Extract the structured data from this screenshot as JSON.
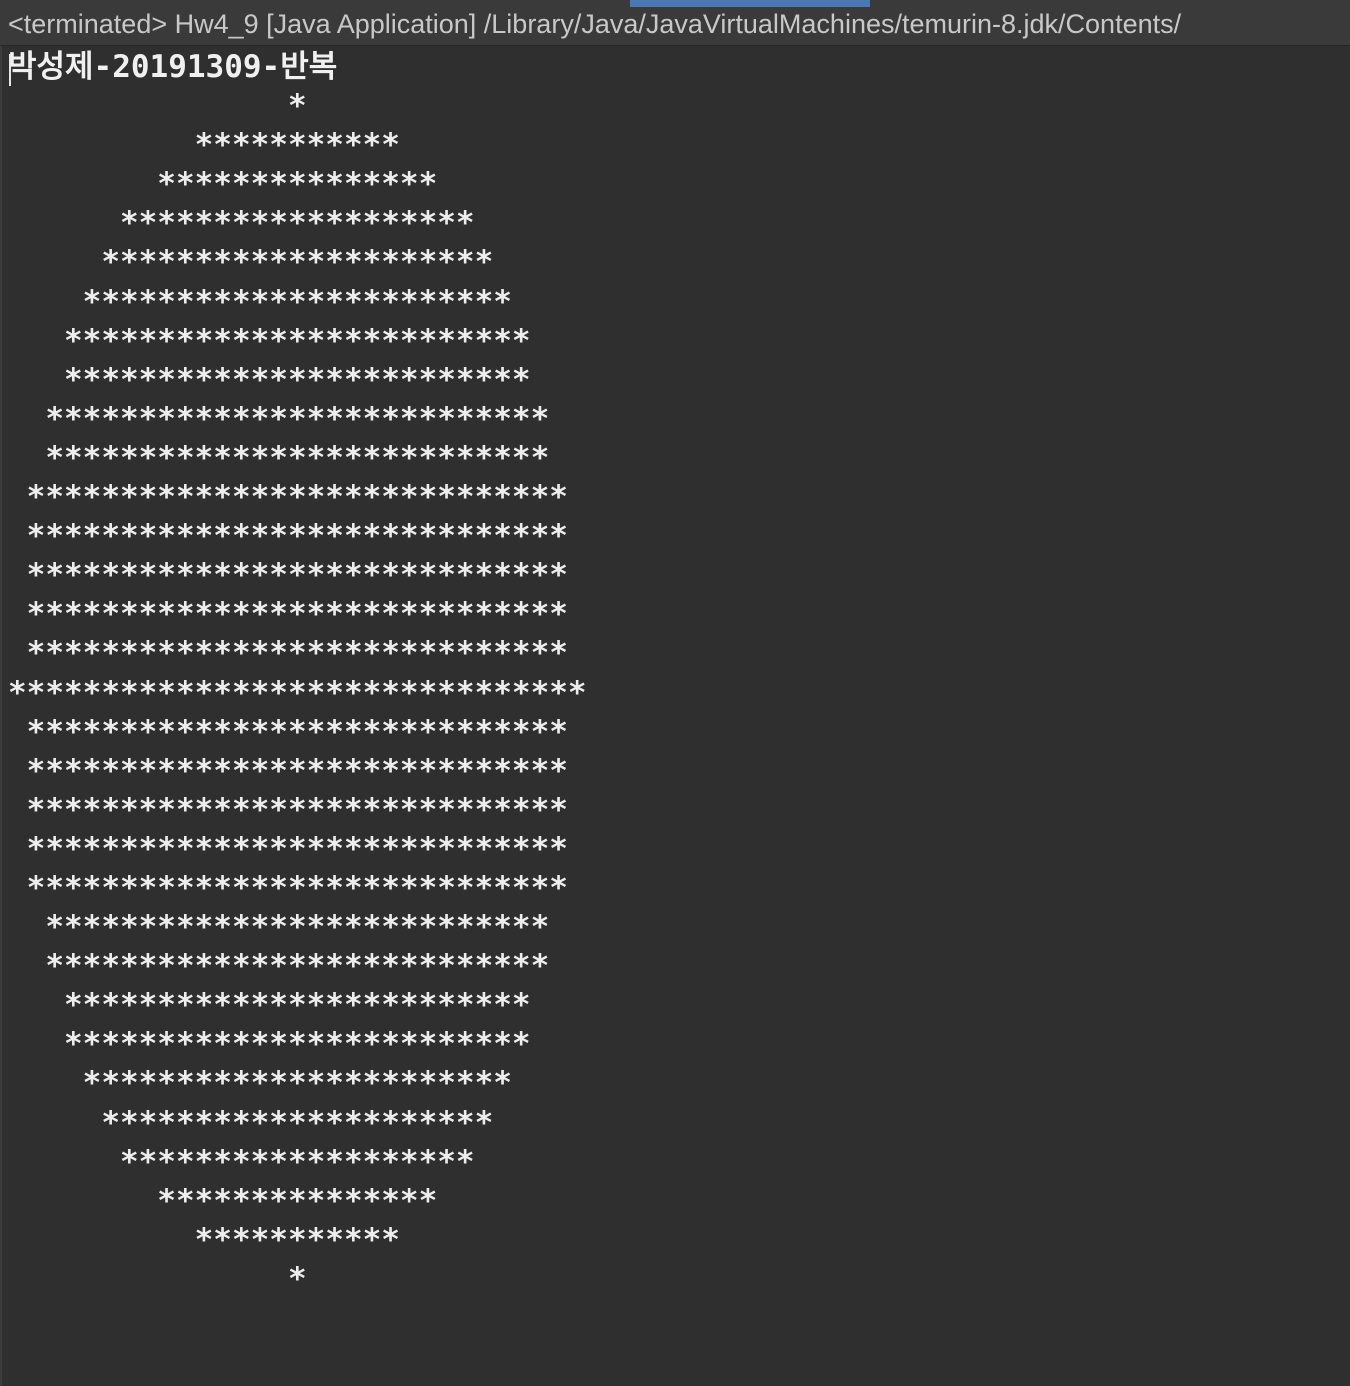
{
  "console": {
    "header": "<terminated> Hw4_9 [Java Application] /Library/Java/JavaVirtualMachines/temurin-8.jdk/Contents/",
    "lines": [
      "박성제-20191309-반복",
      "               *",
      "          ***********",
      "        ***************",
      "      *******************",
      "     *********************",
      "    ***********************",
      "   *************************",
      "   *************************",
      "  ***************************",
      "  ***************************",
      " *****************************",
      " *****************************",
      " *****************************",
      " *****************************",
      " *****************************",
      "*******************************",
      " *****************************",
      " *****************************",
      " *****************************",
      " *****************************",
      " *****************************",
      "  ***************************",
      "  ***************************",
      "   *************************",
      "   *************************",
      "    ***********************",
      "     *********************",
      "      *******************",
      "        ***************",
      "          ***********",
      "               *"
    ]
  },
  "colors": {
    "background": "#2f2f2f",
    "header_background": "#3a3a3a",
    "accent": "#4a78b4",
    "text": "#ededed"
  }
}
